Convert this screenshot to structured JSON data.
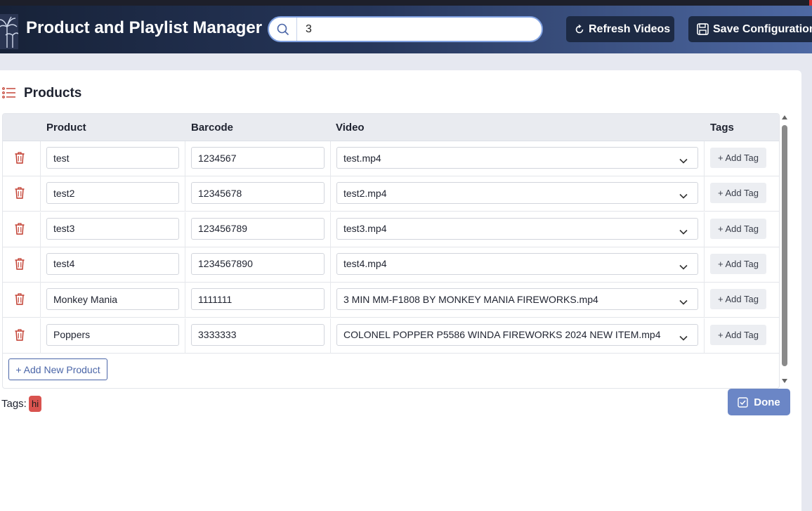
{
  "header": {
    "title": "Product and Playlist Manager",
    "search_value": "3",
    "refresh_label": "Refresh Videos",
    "save_label": "Save Configuration"
  },
  "panel": {
    "title": "Products"
  },
  "table": {
    "columns": [
      "Product",
      "Barcode",
      "Video",
      "Tags"
    ],
    "rows": [
      {
        "product": "test",
        "barcode": "1234567",
        "video": "test.mp4",
        "tag_label": "+ Add Tag"
      },
      {
        "product": "test2",
        "barcode": "12345678",
        "video": "test2.mp4",
        "tag_label": "+ Add Tag"
      },
      {
        "product": "test3",
        "barcode": "123456789",
        "video": "test3.mp4",
        "tag_label": "+ Add Tag"
      },
      {
        "product": "test4",
        "barcode": "1234567890",
        "video": "test4.mp4",
        "tag_label": "+ Add Tag"
      },
      {
        "product": "Monkey Mania",
        "barcode": "1111111",
        "video": "3 MIN MM-F1808 BY MONKEY MANIA FIREWORKS.mp4",
        "tag_label": "+ Add Tag"
      },
      {
        "product": "Poppers",
        "barcode": "3333333",
        "video": "COLONEL POPPER P5586 WINDA FIREWORKS 2024 NEW ITEM.mp4",
        "tag_label": "+ Add Tag"
      }
    ],
    "add_product_label": "+ Add New Product"
  },
  "tags": {
    "label": "Tags:",
    "items": [
      "hi"
    ]
  },
  "done_label": "Done",
  "colors": {
    "accent": "#4b66a8",
    "tag_chip": "#d9534f",
    "trash": "#c0392b",
    "done_button": "#6b86c6"
  },
  "icons": {
    "logo": "palm-fireworks-icon",
    "search": "search-icon",
    "refresh": "refresh-icon",
    "save": "save-icon",
    "list": "list-icon",
    "delete": "trash-icon",
    "dropdown": "chevron-down-icon",
    "done": "check-square-icon"
  }
}
